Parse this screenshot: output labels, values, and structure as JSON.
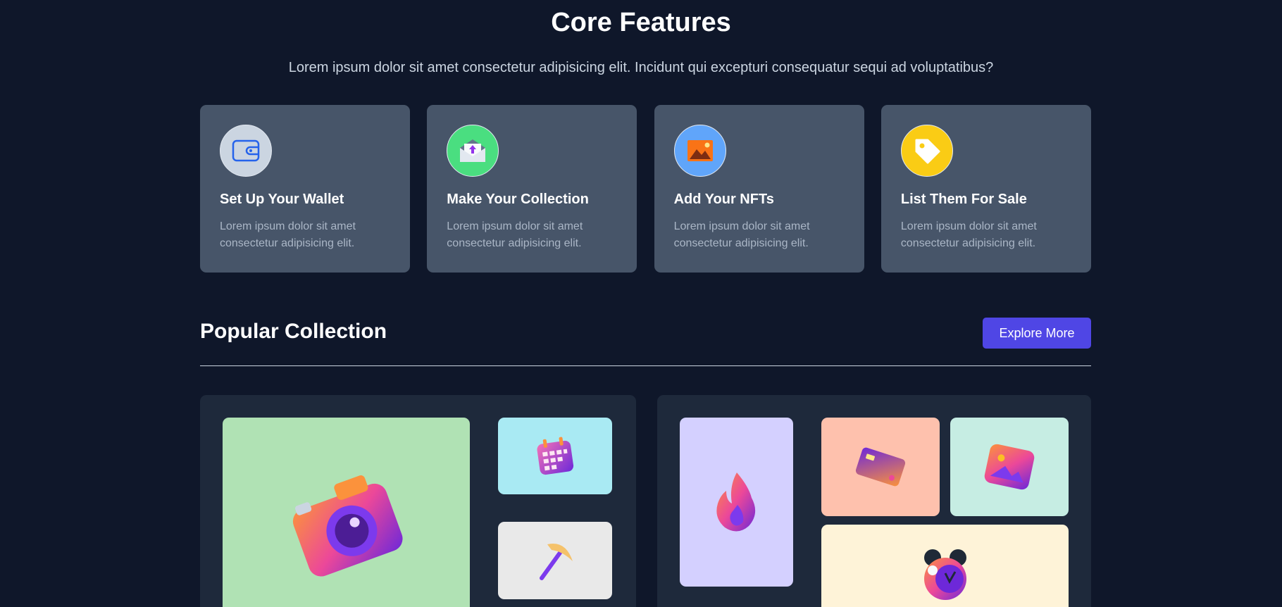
{
  "features": {
    "title": "Core Features",
    "subtitle": "Lorem ipsum dolor sit amet consectetur adipisicing elit. Incidunt qui excepturi consequatur sequi ad voluptatibus?",
    "cards": [
      {
        "title": "Set Up Your Wallet",
        "description": "Lorem ipsum dolor sit amet consectetur adipisicing elit.",
        "icon": "wallet-icon",
        "icon_bg": "#cbd5e1"
      },
      {
        "title": "Make Your Collection",
        "description": "Lorem ipsum dolor sit amet consectetur adipisicing elit.",
        "icon": "envelope-upload-icon",
        "icon_bg": "#4ade80"
      },
      {
        "title": "Add Your NFTs",
        "description": "Lorem ipsum dolor sit amet consectetur adipisicing elit.",
        "icon": "image-icon",
        "icon_bg": "#60a5fa"
      },
      {
        "title": "List Them For Sale",
        "description": "Lorem ipsum dolor sit amet consectetur adipisicing elit.",
        "icon": "price-tag-icon",
        "icon_bg": "#facc15"
      }
    ]
  },
  "popular": {
    "title": "Popular Collection",
    "explore_label": "Explore More",
    "left_tiles": [
      {
        "icon": "camera-icon",
        "bg": "#b0e2b4"
      },
      {
        "icon": "calendar-icon",
        "bg": "#a9eaf3"
      },
      {
        "icon": "pickaxe-icon",
        "bg": "#e9e9e9"
      }
    ],
    "right_tiles": [
      {
        "icon": "fire-icon",
        "bg": "#d4d0ff"
      },
      {
        "icon": "credit-card-icon",
        "bg": "#fec1ad"
      },
      {
        "icon": "photo-icon",
        "bg": "#c6ede3"
      },
      {
        "icon": "alarm-clock-icon",
        "bg": "#fef3d8"
      }
    ]
  },
  "colors": {
    "background": "#0f172a",
    "card": "#475569",
    "panel": "#1e293b",
    "accent": "#4f46e5"
  }
}
